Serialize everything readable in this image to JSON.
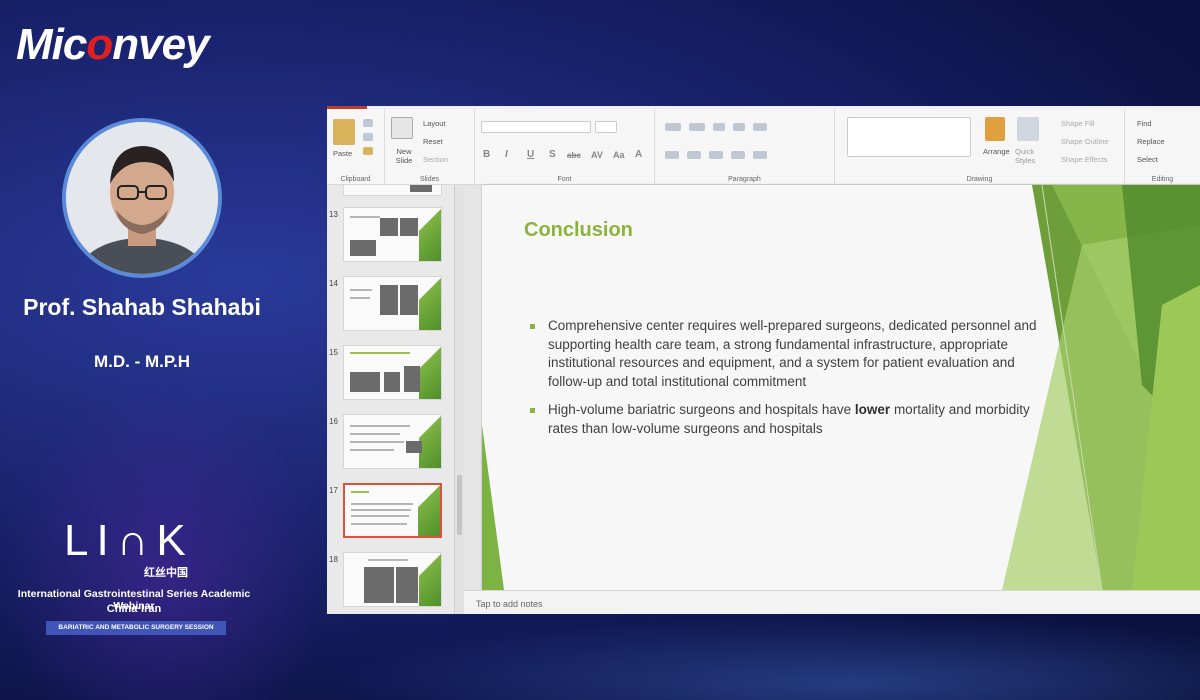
{
  "branding": {
    "logo_prefix": "Mic",
    "logo_o": "o",
    "logo_suffix": "nvey"
  },
  "speaker": {
    "name": "Prof. Shahab Shahabi",
    "title": "M.D. - M.P.H"
  },
  "event": {
    "logo_text": "LI∩K",
    "logo_subtitle": "红丝中国",
    "series": "International Gastrointestinal Series Academic Webinar",
    "countries": "China·Iran",
    "session": "BARIATRIC AND METABOLIC SURGERY SESSION"
  },
  "ribbon": {
    "groups": [
      "Clipboard",
      "Slides",
      "Font",
      "Paragraph",
      "Drawing",
      "Editing"
    ],
    "paste": "Paste",
    "new_slide": "New Slide",
    "layout": "Layout",
    "reset": "Reset",
    "section": "Section",
    "arrange": "Arrange",
    "quick_styles": "Quick Styles",
    "shape_fill": "Shape Fill",
    "shape_outline": "Shape Outline",
    "shape_effects": "Shape Effects",
    "find": "Find",
    "replace": "Replace",
    "select": "Select",
    "font_buttons": [
      "B",
      "I",
      "U",
      "S",
      "abc",
      "AV",
      "Aa",
      "A"
    ]
  },
  "thumbnails": [
    {
      "number": "13",
      "active": false
    },
    {
      "number": "14",
      "active": false
    },
    {
      "number": "15",
      "active": false
    },
    {
      "number": "16",
      "active": false
    },
    {
      "number": "17",
      "active": true
    },
    {
      "number": "18",
      "active": false
    }
  ],
  "slide": {
    "title": "Conclusion",
    "bullet1": "Comprehensive center requires well-prepared surgeons, dedicated personnel and supporting health care team, a strong fundamental infrastructure, appropriate institutional resources and equipment, and a system for patient evaluation and follow-up and total institutional commitment",
    "bullet2_before": "High-volume bariatric surgeons and hospitals have ",
    "bullet2_bold": "lower",
    "bullet2_after": " mortality and morbidity rates than low-volume surgeons and hospitals"
  },
  "notes_placeholder": "Tap to add notes",
  "colors": {
    "accent_green": "#8cb43a",
    "dark_green": "#4f8f2a",
    "active_thumb_border": "#d4553d"
  }
}
